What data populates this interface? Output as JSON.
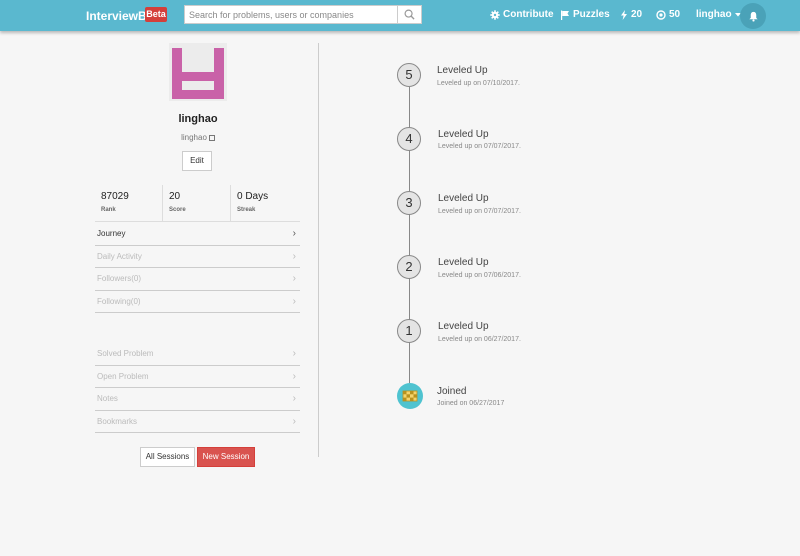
{
  "navbar": {
    "brand": "InterviewBit",
    "badge": "Beta",
    "search_placeholder": "Search for problems, users or companies",
    "contribute": "Contribute",
    "puzzles": "Puzzles",
    "streak_count": "20",
    "coins": "50",
    "username": "linghao",
    "bg_color": "#5ab8cf"
  },
  "profile": {
    "name": "linghao",
    "handle": "linghao",
    "edit_label": "Edit",
    "stats": [
      {
        "value": "87029",
        "label": "Rank"
      },
      {
        "value": "20",
        "label": "Score"
      },
      {
        "value": "0 Days",
        "label": "Streak"
      }
    ],
    "menu_top": [
      {
        "label": "Journey",
        "active": true
      },
      {
        "label": "Daily Activity",
        "active": false
      },
      {
        "label": "Followers(0)",
        "active": false
      },
      {
        "label": "Following(0)",
        "active": false
      }
    ],
    "menu_bottom": [
      {
        "label": "Solved Problem"
      },
      {
        "label": "Open Problem"
      },
      {
        "label": "Notes"
      },
      {
        "label": "Bookmarks"
      }
    ],
    "all_sessions": "All Sessions",
    "new_session": "New Session"
  },
  "timeline": [
    {
      "level": "5",
      "title": "Leveled Up",
      "sub": "Leveled up on 07/10/2017."
    },
    {
      "level": "4",
      "title": "Leveled Up",
      "sub": "Leveled up on 07/07/2017."
    },
    {
      "level": "3",
      "title": "Leveled Up",
      "sub": "Leveled up on 07/07/2017."
    },
    {
      "level": "2",
      "title": "Leveled Up",
      "sub": "Leveled up on 07/06/2017."
    },
    {
      "level": "1",
      "title": "Leveled Up",
      "sub": "Leveled up on 06/27/2017."
    }
  ],
  "joined": {
    "title": "Joined",
    "sub": "Joined on 06/27/2017"
  }
}
